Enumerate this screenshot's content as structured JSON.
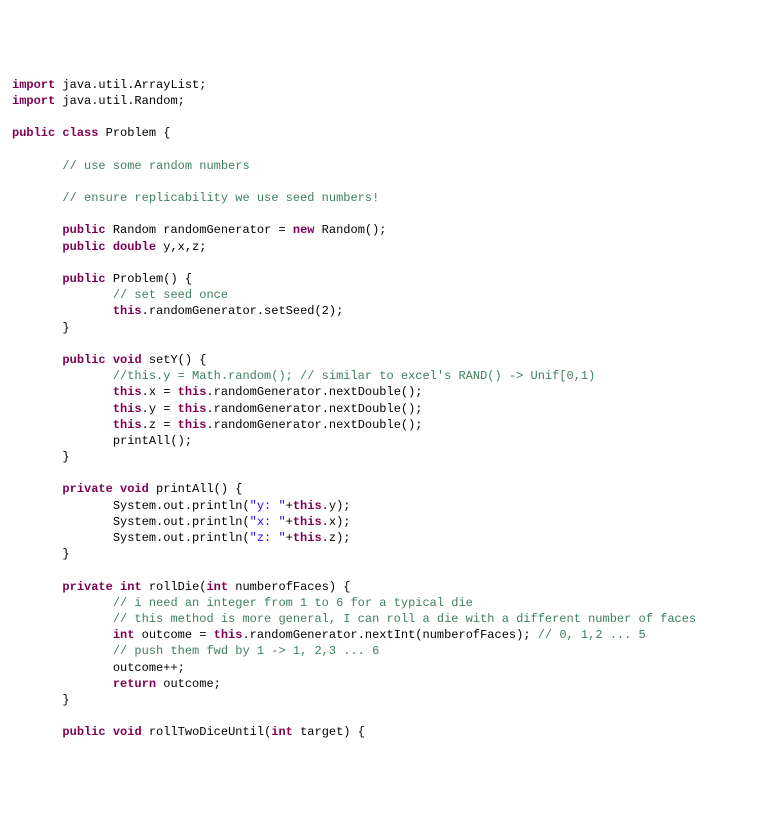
{
  "code": {
    "lines": [
      {
        "t": "plain",
        "frag": [
          {
            "c": "kw",
            "v": "import"
          },
          {
            "c": "",
            "v": " java.util.ArrayList;"
          }
        ]
      },
      {
        "t": "plain",
        "frag": [
          {
            "c": "kw",
            "v": "import"
          },
          {
            "c": "",
            "v": " java.util.Random;"
          }
        ]
      },
      {
        "t": "blank"
      },
      {
        "t": "plain",
        "frag": [
          {
            "c": "kw",
            "v": "public"
          },
          {
            "c": "",
            "v": " "
          },
          {
            "c": "kw",
            "v": "class"
          },
          {
            "c": "",
            "v": " Problem {"
          }
        ]
      },
      {
        "t": "blank"
      },
      {
        "t": "plain",
        "frag": [
          {
            "c": "",
            "v": "       "
          },
          {
            "c": "cm",
            "v": "// use some random numbers"
          }
        ]
      },
      {
        "t": "blank"
      },
      {
        "t": "plain",
        "frag": [
          {
            "c": "",
            "v": "       "
          },
          {
            "c": "cm",
            "v": "// ensure replicability we use seed numbers!"
          }
        ]
      },
      {
        "t": "blank"
      },
      {
        "t": "plain",
        "frag": [
          {
            "c": "",
            "v": "       "
          },
          {
            "c": "kw",
            "v": "public"
          },
          {
            "c": "",
            "v": " Random randomGenerator = "
          },
          {
            "c": "kw",
            "v": "new"
          },
          {
            "c": "",
            "v": " Random();"
          }
        ]
      },
      {
        "t": "plain",
        "frag": [
          {
            "c": "",
            "v": "       "
          },
          {
            "c": "kw",
            "v": "public"
          },
          {
            "c": "",
            "v": " "
          },
          {
            "c": "kw",
            "v": "double"
          },
          {
            "c": "",
            "v": " y,x,z;"
          }
        ]
      },
      {
        "t": "blank"
      },
      {
        "t": "plain",
        "frag": [
          {
            "c": "",
            "v": "       "
          },
          {
            "c": "kw",
            "v": "public"
          },
          {
            "c": "",
            "v": " Problem() {"
          }
        ]
      },
      {
        "t": "plain",
        "frag": [
          {
            "c": "",
            "v": "              "
          },
          {
            "c": "cm",
            "v": "// set seed once"
          }
        ]
      },
      {
        "t": "plain",
        "frag": [
          {
            "c": "",
            "v": "              "
          },
          {
            "c": "kw",
            "v": "this"
          },
          {
            "c": "",
            "v": ".randomGenerator.setSeed(2);"
          }
        ]
      },
      {
        "t": "plain",
        "frag": [
          {
            "c": "",
            "v": "       }"
          }
        ]
      },
      {
        "t": "blank"
      },
      {
        "t": "plain",
        "frag": [
          {
            "c": "",
            "v": "       "
          },
          {
            "c": "kw",
            "v": "public"
          },
          {
            "c": "",
            "v": " "
          },
          {
            "c": "kw",
            "v": "void"
          },
          {
            "c": "",
            "v": " setY() {"
          }
        ]
      },
      {
        "t": "plain",
        "frag": [
          {
            "c": "",
            "v": "              "
          },
          {
            "c": "cm",
            "v": "//this.y = Math.random(); // similar to excel's RAND() -> Unif[0,1)"
          }
        ]
      },
      {
        "t": "plain",
        "frag": [
          {
            "c": "",
            "v": "              "
          },
          {
            "c": "kw",
            "v": "this"
          },
          {
            "c": "",
            "v": ".x = "
          },
          {
            "c": "kw",
            "v": "this"
          },
          {
            "c": "",
            "v": ".randomGenerator.nextDouble();"
          }
        ]
      },
      {
        "t": "plain",
        "frag": [
          {
            "c": "",
            "v": "              "
          },
          {
            "c": "kw",
            "v": "this"
          },
          {
            "c": "",
            "v": ".y = "
          },
          {
            "c": "kw",
            "v": "this"
          },
          {
            "c": "",
            "v": ".randomGenerator.nextDouble();"
          }
        ]
      },
      {
        "t": "plain",
        "frag": [
          {
            "c": "",
            "v": "              "
          },
          {
            "c": "kw",
            "v": "this"
          },
          {
            "c": "",
            "v": ".z = "
          },
          {
            "c": "kw",
            "v": "this"
          },
          {
            "c": "",
            "v": ".randomGenerator.nextDouble();"
          }
        ]
      },
      {
        "t": "plain",
        "frag": [
          {
            "c": "",
            "v": "              printAll();"
          }
        ]
      },
      {
        "t": "plain",
        "frag": [
          {
            "c": "",
            "v": "       }"
          }
        ]
      },
      {
        "t": "blank"
      },
      {
        "t": "plain",
        "frag": [
          {
            "c": "",
            "v": "       "
          },
          {
            "c": "kw",
            "v": "private"
          },
          {
            "c": "",
            "v": " "
          },
          {
            "c": "kw",
            "v": "void"
          },
          {
            "c": "",
            "v": " printAll() {"
          }
        ]
      },
      {
        "t": "plain",
        "frag": [
          {
            "c": "",
            "v": "              System.out.println("
          },
          {
            "c": "str",
            "v": "\"y: \""
          },
          {
            "c": "",
            "v": "+"
          },
          {
            "c": "kw",
            "v": "this"
          },
          {
            "c": "",
            "v": ".y);"
          }
        ]
      },
      {
        "t": "plain",
        "frag": [
          {
            "c": "",
            "v": "              System.out.println("
          },
          {
            "c": "str",
            "v": "\"x: \""
          },
          {
            "c": "",
            "v": "+"
          },
          {
            "c": "kw",
            "v": "this"
          },
          {
            "c": "",
            "v": ".x);"
          }
        ]
      },
      {
        "t": "plain",
        "frag": [
          {
            "c": "",
            "v": "              System.out.println("
          },
          {
            "c": "str",
            "v": "\"z: \""
          },
          {
            "c": "",
            "v": "+"
          },
          {
            "c": "kw",
            "v": "this"
          },
          {
            "c": "",
            "v": ".z);"
          }
        ]
      },
      {
        "t": "plain",
        "frag": [
          {
            "c": "",
            "v": "       }"
          }
        ]
      },
      {
        "t": "blank"
      },
      {
        "t": "plain",
        "frag": [
          {
            "c": "",
            "v": "       "
          },
          {
            "c": "kw",
            "v": "private"
          },
          {
            "c": "",
            "v": " "
          },
          {
            "c": "kw",
            "v": "int"
          },
          {
            "c": "",
            "v": " rollDie("
          },
          {
            "c": "kw",
            "v": "int"
          },
          {
            "c": "",
            "v": " numberofFaces) {"
          }
        ]
      },
      {
        "t": "plain",
        "frag": [
          {
            "c": "",
            "v": "              "
          },
          {
            "c": "cm",
            "v": "// i need an integer from 1 to 6 for a typical die"
          }
        ]
      },
      {
        "t": "plain",
        "frag": [
          {
            "c": "",
            "v": "              "
          },
          {
            "c": "cm",
            "v": "// this method is more general, I can roll a die with a different number of faces"
          }
        ]
      },
      {
        "t": "plain",
        "frag": [
          {
            "c": "",
            "v": "              "
          },
          {
            "c": "kw",
            "v": "int"
          },
          {
            "c": "",
            "v": " outcome = "
          },
          {
            "c": "kw",
            "v": "this"
          },
          {
            "c": "",
            "v": ".randomGenerator.nextInt(numberofFaces); "
          },
          {
            "c": "cm",
            "v": "// 0, 1,2 ... 5"
          }
        ]
      },
      {
        "t": "plain",
        "frag": [
          {
            "c": "",
            "v": "              "
          },
          {
            "c": "cm",
            "v": "// push them fwd by 1 -> 1, 2,3 ... 6"
          }
        ]
      },
      {
        "t": "plain",
        "frag": [
          {
            "c": "",
            "v": "              outcome++;"
          }
        ]
      },
      {
        "t": "plain",
        "frag": [
          {
            "c": "",
            "v": "              "
          },
          {
            "c": "kw",
            "v": "return"
          },
          {
            "c": "",
            "v": " outcome;"
          }
        ]
      },
      {
        "t": "plain",
        "frag": [
          {
            "c": "",
            "v": "       }"
          }
        ]
      },
      {
        "t": "blank"
      },
      {
        "t": "plain",
        "frag": [
          {
            "c": "",
            "v": "       "
          },
          {
            "c": "kw",
            "v": "public"
          },
          {
            "c": "",
            "v": " "
          },
          {
            "c": "kw",
            "v": "void"
          },
          {
            "c": "",
            "v": " rollTwoDiceUntil("
          },
          {
            "c": "kw",
            "v": "int"
          },
          {
            "c": "",
            "v": " target) {"
          }
        ]
      }
    ]
  }
}
